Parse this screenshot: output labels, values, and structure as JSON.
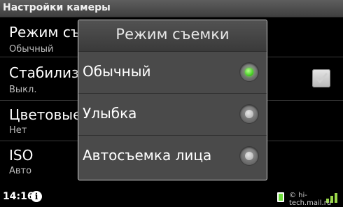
{
  "titlebar": {
    "title": "Настройки камеры"
  },
  "settings": [
    {
      "label": "Режим съемки",
      "value": "Обычный"
    },
    {
      "label": "Стабилизация",
      "value": "Выкл.",
      "checked": false
    },
    {
      "label": "Цветовые эффекты",
      "value": "Нет"
    },
    {
      "label": "ISO",
      "value": "Авто"
    }
  ],
  "dialog": {
    "title": "Режим съемки",
    "options": [
      {
        "label": "Обычный",
        "selected": true
      },
      {
        "label": "Улыбка",
        "selected": false
      },
      {
        "label": "Автосъемка лица",
        "selected": false
      }
    ]
  },
  "statusbar": {
    "time": "14:16",
    "info_icon": "i",
    "watermark": "© hi-tech.mail.ru"
  },
  "colors": {
    "selected_radio": "#3cc91b",
    "dialog_bg": "#4a4a4a",
    "titlebar_bg": "#4f4f4f"
  }
}
